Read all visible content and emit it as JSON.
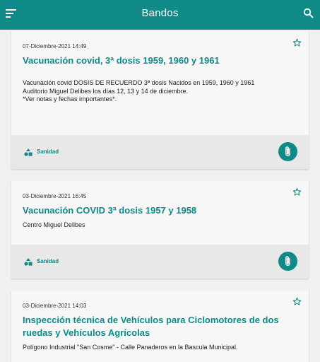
{
  "header": {
    "title": "Bandos"
  },
  "cards": [
    {
      "date": "07-Diciembre-2021 14:49",
      "title": "Vacunación covid, 3ª dosis 1959, 1960 y 1961",
      "description": [
        "Vacunación covid DOSIS DE RECUERDO 3ª dosis Nacidos en 1959, 1960 y 1961",
        "Auditorio Miguel Delibes los días 12, 13 y 14 de diciembre.",
        "*Ver notas y fechas importantes*."
      ],
      "category": "Sanidad"
    },
    {
      "date": "03-Diciembre-2021 16:45",
      "title": "Vacunación COVID 3ª dosis 1957 y 1958",
      "description": [
        "Centro Miguel Delibes"
      ],
      "category": "Sanidad"
    },
    {
      "date": "03-Diciembre-2021 14:03",
      "title_lines": [
        "Inspección técnica de Vehículos para Ciclomotores de dos",
        "ruedas y Vehículos Agrícolas"
      ],
      "description": [
        "Polígono Industrial \"San Cosme\" - Calle Panaderos en la Bascula Municipal."
      ]
    }
  ],
  "icons": {
    "menu": "menu-icon",
    "search": "search-icon",
    "star": "star-outline-icon",
    "category": "category-shapes-icon",
    "attachment": "paperclip-icon"
  },
  "colors": {
    "primary": "#0f8a86",
    "background": "#f0f0f0",
    "card": "#f7f7f7",
    "footer": "#e8e8e8"
  }
}
